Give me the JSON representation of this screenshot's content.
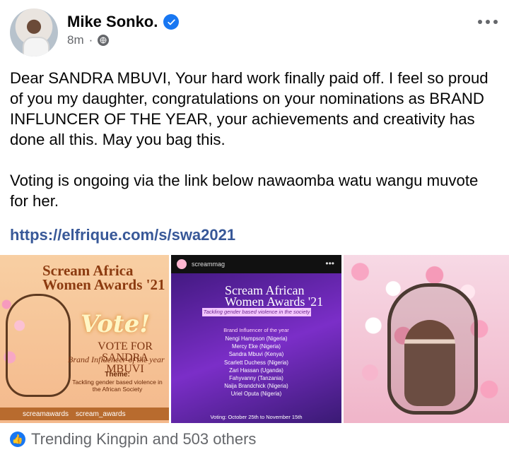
{
  "post": {
    "author": "Mike Sonko.",
    "time": "8m",
    "paragraph1": "Dear SANDRA MBUVI, Your hard work finally paid off. I feel so proud of you my daughter, congratulations on your nominations as BRAND INFLUNCER OF THE YEAR, your  achievements and creativity has done all this. May you bag this.",
    "paragraph2": "Voting is ongoing via the link below nawaomba watu wangu muvote for her.",
    "link": "https://elfrique.com/s/swa2021",
    "reactions": "Trending Kingpin and 503 others"
  },
  "photo1": {
    "title1": "Scream Africa",
    "title2": "Women Awards '21",
    "vote": "Vote!",
    "vote_for": "VOTE FOR",
    "name": "SANDRA MBUVI",
    "category": "Brand Influencer of the year",
    "theme_label": "Theme:",
    "theme_text": "Tackling gender based violence in the African Society",
    "social1": "screamawards",
    "social2": "scream_awards"
  },
  "photo2": {
    "account": "screammag",
    "title1": "Scream African",
    "title2": "Women Awards '21",
    "tagline": "Tackling gender based violence in the society",
    "category": "Brand Influencer of the year",
    "nominees": [
      "Nengi Hampson (Nigeria)",
      "Mercy Eke (Nigeria)",
      "Sandra Mbuvi (Kenya)",
      "Scarlett Duchess (Nigeria)",
      "Zari Hassan (Uganda)",
      "Fahyvanny (Tanzania)",
      "Naija Brandchick (Nigeria)",
      "Uriel Oputa (Nigeria)"
    ],
    "voting": "Voting: October 25th to November 15th"
  },
  "colors": {
    "facebook_blue": "#1877f2",
    "link": "#385898",
    "muted": "#65676b"
  },
  "icons": {
    "verified": "verified-check-icon",
    "globe": "globe-icon",
    "more": "more-options-icon",
    "like": "like-icon"
  }
}
